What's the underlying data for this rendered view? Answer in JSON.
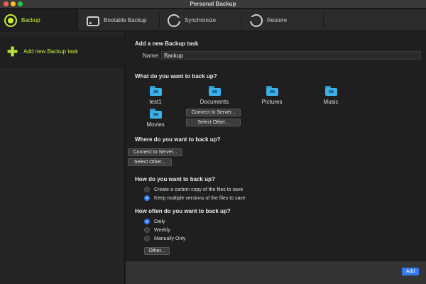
{
  "window": {
    "title": "Personal Backup"
  },
  "tabs": [
    {
      "label": "Backup",
      "icon": "backup-icon"
    },
    {
      "label": "Bootable Backup",
      "icon": "drive-icon"
    },
    {
      "label": "Synchronize",
      "icon": "sync-icon"
    },
    {
      "label": "Restore",
      "icon": "restore-icon"
    }
  ],
  "sidebar": {
    "add_task_label": "Add new Backup task"
  },
  "main": {
    "new_task_heading": "Add a new Backup task",
    "name_label": "Name:",
    "name_value": "Backup",
    "what_heading": "What do you want to back up?",
    "folders": [
      "test1",
      "Documents",
      "Pictures",
      "Music",
      "Movies"
    ],
    "what_connect": "Connect to Server...",
    "what_select": "Select Other...",
    "where_heading": "Where do you want to back up?",
    "where_connect": "Connect to Server...",
    "where_select": "Select Other...",
    "how_heading": "How do you want to back up?",
    "how_options": [
      {
        "label": "Create a carbon copy of the files to save",
        "selected": false
      },
      {
        "label": "Keep multiple versions of the files to save",
        "selected": true
      }
    ],
    "often_heading": "How often do you want to back up?",
    "often_options": [
      {
        "label": "Daily",
        "selected": true
      },
      {
        "label": "Weekly",
        "selected": false
      },
      {
        "label": "Manually Only",
        "selected": false
      }
    ],
    "other_button": "Other..."
  },
  "footer": {
    "add_label": "Add"
  },
  "colors": {
    "accent": "#c5ef3b",
    "selection": "#2f7cf6",
    "folder": "#3db0e8"
  }
}
